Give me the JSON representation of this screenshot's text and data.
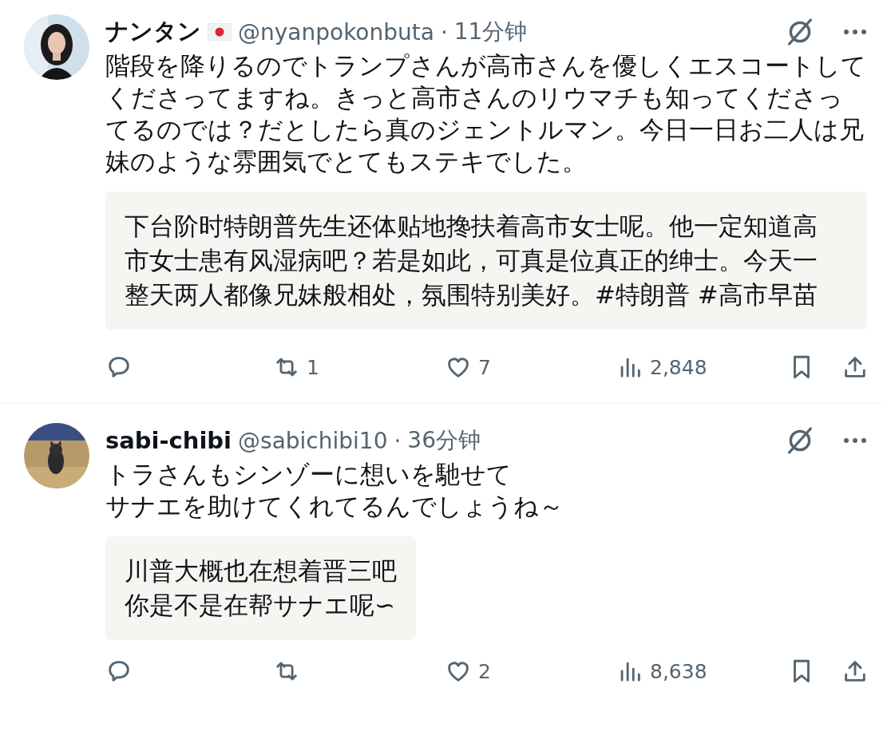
{
  "posts": [
    {
      "name": "ナンタン",
      "flag": true,
      "handle": "@nyanpokonbuta",
      "separator": "·",
      "time": "11分钟",
      "lines": [
        "階段を降りるのでトランプさんが高市さんを優しくエスコートしてくださってますね。きっと高市さんのリウマチも知ってくださってるのでは？だとしたら真のジェントルマン。今日一日お二人は兄妹のような雰囲気でとてもステキでした。"
      ],
      "translation": {
        "wide": true,
        "lines": [
          "下台阶时特朗普先生还体贴地搀扶着高市女士呢。他一定知道高市女士患有风湿病吧？若是如此，可真是位真正的绅士。今天一整天两人都像兄妹般相处，氛围特别美好。#特朗普 #高市早苗"
        ]
      },
      "stats": {
        "retweets": "1",
        "likes": "7",
        "views": "2,848"
      }
    },
    {
      "name": "sabi-chibi",
      "flag": false,
      "handle": "@sabichibi10",
      "separator": "·",
      "time": "36分钟",
      "lines": [
        "トラさんもシンゾーに想いを馳せて",
        "サナエを助けてくれてるんでしょうね～"
      ],
      "translation": {
        "wide": false,
        "lines": [
          "川普大概也在想着晋三吧",
          "你是不是在帮サナエ呢∽"
        ]
      },
      "stats": {
        "likes": "2",
        "views": "8,638"
      }
    }
  ]
}
